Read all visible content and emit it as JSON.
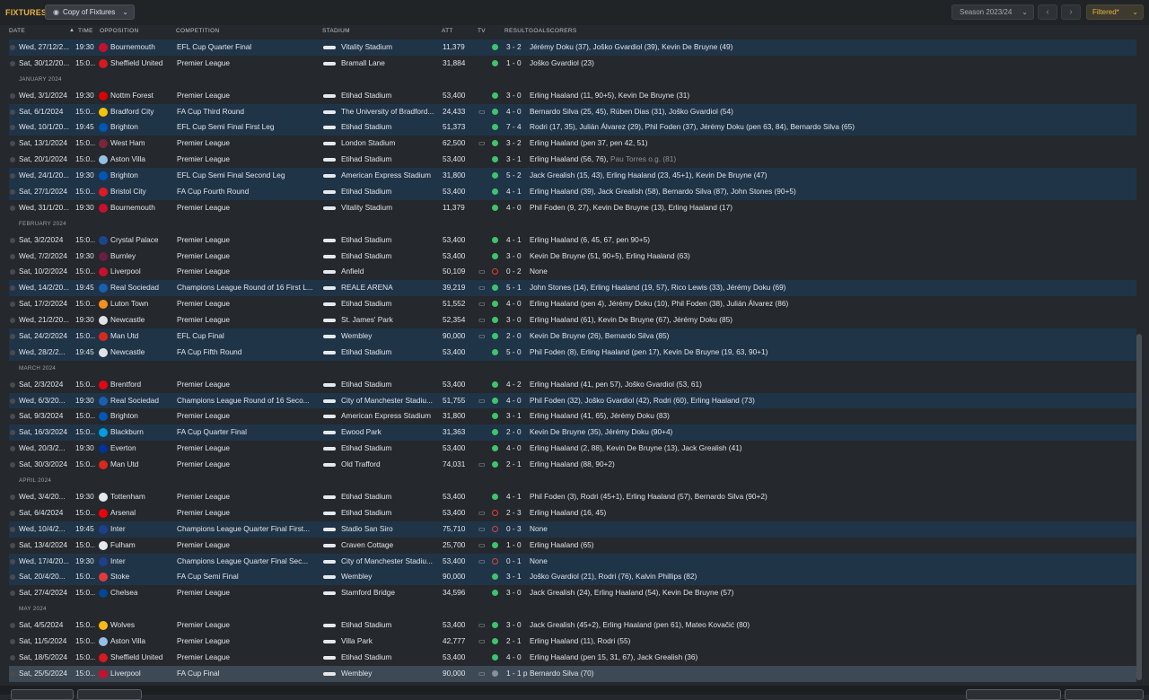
{
  "topbar": {
    "title": "FIXTURES",
    "view_label": "Copy of Fixtures",
    "view_icon": "eye-icon",
    "season_label": "Season 2023/24",
    "prev_icon": "chevron-left-icon",
    "next_icon": "chevron-right-icon",
    "filter_label": "Filtered*",
    "accent_color": "#e8b33c"
  },
  "columns": {
    "date": "DATE",
    "time": "TIME",
    "opposition": "OPPOSITION",
    "competition": "COMPETITION",
    "stadium": "STADIUM",
    "att": "ATT",
    "tv": "TV",
    "result": "RESULT",
    "goalscorers": "GOALSCORERS"
  },
  "rows": [
    {
      "type": "match",
      "alt": true,
      "date": "Wed, 27/12/2...",
      "time": "19:30",
      "badge": "#c8102e",
      "opp": "Bournemouth",
      "comp": "EFL Cup Quarter Final",
      "stadium": "Vitality Stadium",
      "att": "11,379",
      "tv": false,
      "res": "W",
      "score": "3 - 2",
      "scorers": "Jérémy Doku (37), Joško Gvardiol (39), Kevin De Bruyne (49)"
    },
    {
      "type": "match",
      "date": "Sat, 30/12/20...",
      "time": "15:0...",
      "badge": "#d71920",
      "opp": "Sheffield United",
      "comp": "Premier League",
      "stadium": "Bramall Lane",
      "att": "31,884",
      "tv": false,
      "res": "W",
      "score": "1 - 0",
      "scorers": "Joško Gvardiol (23)"
    },
    {
      "type": "month",
      "label": "JANUARY 2024"
    },
    {
      "type": "match",
      "date": "Wed, 3/1/2024",
      "time": "19:30",
      "badge": "#dd0000",
      "opp": "Nottm Forest",
      "comp": "Premier League",
      "stadium": "Etihad Stadium",
      "att": "53,400",
      "tv": false,
      "res": "W",
      "score": "3 - 0",
      "scorers": "Erling Haaland (11, 90+5), Kevin De Bruyne (31)"
    },
    {
      "type": "match",
      "alt": true,
      "date": "Sat, 6/1/2024",
      "time": "15:0...",
      "badge": "#f5c400",
      "opp": "Bradford City",
      "comp": "FA Cup Third Round",
      "stadium": "The University of Bradford...",
      "att": "24,433",
      "tv": true,
      "res": "W",
      "score": "4 - 0",
      "scorers": "Bernardo Silva (25, 45), Rúben Dias (31), Joško Gvardiol (54)"
    },
    {
      "type": "match",
      "alt": true,
      "date": "Wed, 10/1/20...",
      "time": "19:45",
      "badge": "#0057b8",
      "opp": "Brighton",
      "comp": "EFL Cup Semi Final First Leg",
      "stadium": "Etihad Stadium",
      "att": "51,373",
      "tv": false,
      "res": "W",
      "score": "7 - 4",
      "scorers": "Rodri (17, 35), Julián Álvarez (29), Phil Foden (37), Jérémy Doku (pen 63, 84), Bernardo Silva (65)"
    },
    {
      "type": "match",
      "date": "Sat, 13/1/2024",
      "time": "15:0...",
      "badge": "#7a263a",
      "opp": "West Ham",
      "comp": "Premier League",
      "stadium": "London Stadium",
      "att": "62,500",
      "tv": true,
      "res": "W",
      "score": "3 - 2",
      "scorers": "Erling Haaland (pen 37, pen 42, 51)"
    },
    {
      "type": "match",
      "date": "Sat, 20/1/2024",
      "time": "15:0...",
      "badge": "#95bfe5",
      "opp": "Aston Villa",
      "comp": "Premier League",
      "stadium": "Etihad Stadium",
      "att": "53,400",
      "tv": false,
      "res": "W",
      "score": "3 - 1",
      "scorers": "Erling Haaland (56, 76), ",
      "scorers_muted": "Pau Torres o.g. (81)"
    },
    {
      "type": "match",
      "alt": true,
      "date": "Wed, 24/1/20...",
      "time": "19:30",
      "badge": "#0057b8",
      "opp": "Brighton",
      "comp": "EFL Cup Semi Final Second Leg",
      "stadium": "American Express Stadium",
      "att": "31,800",
      "tv": false,
      "res": "W",
      "score": "5 - 2",
      "scorers": "Jack Grealish (15, 43), Erling Haaland (23, 45+1), Kevin De Bruyne (47)"
    },
    {
      "type": "match",
      "alt": true,
      "date": "Sat, 27/1/2024",
      "time": "15:0...",
      "badge": "#e21a23",
      "opp": "Bristol City",
      "comp": "FA Cup Fourth Round",
      "stadium": "Etihad Stadium",
      "att": "53,400",
      "tv": false,
      "res": "W",
      "score": "4 - 1",
      "scorers": "Erling Haaland (39), Jack Grealish (58), Bernardo Silva (87), John Stones (90+5)"
    },
    {
      "type": "match",
      "date": "Wed, 31/1/20...",
      "time": "19:30",
      "badge": "#c8102e",
      "opp": "Bournemouth",
      "comp": "Premier League",
      "stadium": "Vitality Stadium",
      "att": "11,379",
      "tv": false,
      "res": "W",
      "score": "4 - 0",
      "scorers": "Phil Foden (9, 27), Kevin De Bruyne (13), Erling Haaland (17)"
    },
    {
      "type": "month",
      "label": "FEBRUARY 2024"
    },
    {
      "type": "match",
      "date": "Sat, 3/2/2024",
      "time": "15:0...",
      "badge": "#1b458f",
      "opp": "Crystal Palace",
      "comp": "Premier League",
      "stadium": "Etihad Stadium",
      "att": "53,400",
      "tv": false,
      "res": "W",
      "score": "4 - 1",
      "scorers": "Erling Haaland (6, 45, 67, pen 90+5)"
    },
    {
      "type": "match",
      "date": "Wed, 7/2/2024",
      "time": "19:30",
      "badge": "#6c1d45",
      "opp": "Burnley",
      "comp": "Premier League",
      "stadium": "Etihad Stadium",
      "att": "53,400",
      "tv": false,
      "res": "W",
      "score": "3 - 0",
      "scorers": "Kevin De Bruyne (51, 90+5), Erling Haaland (63)"
    },
    {
      "type": "match",
      "date": "Sat, 10/2/2024",
      "time": "15:0...",
      "badge": "#c8102e",
      "opp": "Liverpool",
      "comp": "Premier League",
      "stadium": "Anfield",
      "att": "50,109",
      "tv": true,
      "res": "L",
      "score": "0 - 2",
      "scorers": "None"
    },
    {
      "type": "match",
      "alt": true,
      "date": "Wed, 14/2/20...",
      "time": "19:45",
      "badge": "#1c5faf",
      "opp": "Real Sociedad",
      "comp": "Champions League Round of 16  First L...",
      "stadium": "REALE ARENA",
      "att": "39,219",
      "tv": true,
      "res": "W",
      "score": "5 - 1",
      "scorers": "John Stones (14), Erling Haaland (19, 57), Rico Lewis (33), Jérémy Doku (69)"
    },
    {
      "type": "match",
      "date": "Sat, 17/2/2024",
      "time": "15:0...",
      "badge": "#f78f1e",
      "opp": "Luton Town",
      "comp": "Premier League",
      "stadium": "Etihad Stadium",
      "att": "51,552",
      "tv": true,
      "res": "W",
      "score": "4 - 0",
      "scorers": "Erling Haaland (pen 4), Jérémy Doku (10), Phil Foden (38), Julián Álvarez (86)"
    },
    {
      "type": "match",
      "date": "Wed, 21/2/20...",
      "time": "19:30",
      "badge": "#dfe3e6",
      "opp": "Newcastle",
      "comp": "Premier League",
      "stadium": "St. James' Park",
      "att": "52,354",
      "tv": true,
      "res": "W",
      "score": "3 - 0",
      "scorers": "Erling Haaland (61), Kevin De Bruyne (67), Jérémy Doku (85)"
    },
    {
      "type": "match",
      "alt": true,
      "date": "Sat, 24/2/2024",
      "time": "15:0...",
      "badge": "#da291c",
      "opp": "Man Utd",
      "comp": "EFL Cup Final",
      "stadium": "Wembley",
      "att": "90,000",
      "tv": true,
      "res": "W",
      "score": "2 - 0",
      "scorers": "Kevin De Bruyne (26), Bernardo Silva (85)"
    },
    {
      "type": "match",
      "alt": true,
      "date": "Wed, 28/2/2...",
      "time": "19:45",
      "badge": "#dfe3e6",
      "opp": "Newcastle",
      "comp": "FA Cup Fifth Round",
      "stadium": "Etihad Stadium",
      "att": "53,400",
      "tv": false,
      "res": "W",
      "score": "5 - 0",
      "scorers": "Phil Foden (8), Erling Haaland (pen 17), Kevin De Bruyne (19, 63, 90+1)"
    },
    {
      "type": "month",
      "label": "MARCH 2024"
    },
    {
      "type": "match",
      "date": "Sat, 2/3/2024",
      "time": "15:0...",
      "badge": "#e30613",
      "opp": "Brentford",
      "comp": "Premier League",
      "stadium": "Etihad Stadium",
      "att": "53,400",
      "tv": false,
      "res": "W",
      "score": "4 - 2",
      "scorers": "Erling Haaland (41, pen 57), Joško Gvardiol (53, 61)"
    },
    {
      "type": "match",
      "alt": true,
      "date": "Wed, 6/3/20...",
      "time": "19:30",
      "badge": "#1c5faf",
      "opp": "Real Sociedad",
      "comp": "Champions League Round of 16  Seco...",
      "stadium": "City of Manchester Stadiu...",
      "att": "51,755",
      "tv": true,
      "res": "W",
      "score": "4 - 0",
      "scorers": "Phil Foden (32), Joško Gvardiol (42), Rodri (60), Erling Haaland (73)"
    },
    {
      "type": "match",
      "date": "Sat, 9/3/2024",
      "time": "15:0...",
      "badge": "#0057b8",
      "opp": "Brighton",
      "comp": "Premier League",
      "stadium": "American Express Stadium",
      "att": "31,800",
      "tv": false,
      "res": "W",
      "score": "3 - 1",
      "scorers": "Erling Haaland (41, 65), Jérémy Doku (83)"
    },
    {
      "type": "match",
      "alt": true,
      "date": "Sat, 16/3/2024",
      "time": "15:0...",
      "badge": "#009ee0",
      "opp": "Blackburn",
      "comp": "FA Cup Quarter Final",
      "stadium": "Ewood Park",
      "att": "31,363",
      "tv": false,
      "res": "W",
      "score": "2 - 0",
      "scorers": "Kevin De Bruyne (35), Jérémy Doku (90+4)"
    },
    {
      "type": "match",
      "date": "Wed, 20/3/2...",
      "time": "19:30",
      "badge": "#003399",
      "opp": "Everton",
      "comp": "Premier League",
      "stadium": "Etihad Stadium",
      "att": "53,400",
      "tv": false,
      "res": "W",
      "score": "4 - 0",
      "scorers": "Erling Haaland (2, 88), Kevin De Bruyne (13), Jack Grealish (41)"
    },
    {
      "type": "match",
      "date": "Sat, 30/3/2024",
      "time": "15:0...",
      "badge": "#da291c",
      "opp": "Man Utd",
      "comp": "Premier League",
      "stadium": "Old Trafford",
      "att": "74,031",
      "tv": true,
      "res": "W",
      "score": "2 - 1",
      "scorers": "Erling Haaland (88, 90+2)"
    },
    {
      "type": "month",
      "label": "APRIL 2024"
    },
    {
      "type": "match",
      "date": "Wed, 3/4/20...",
      "time": "19:30",
      "badge": "#e6e9ec",
      "opp": "Tottenham",
      "comp": "Premier League",
      "stadium": "Etihad Stadium",
      "att": "53,400",
      "tv": false,
      "res": "W",
      "score": "4 - 1",
      "scorers": "Phil Foden (3), Rodri (45+1), Erling Haaland (57), Bernardo Silva (90+2)"
    },
    {
      "type": "match",
      "date": "Sat, 6/4/2024",
      "time": "15:0...",
      "badge": "#ef0107",
      "opp": "Arsenal",
      "comp": "Premier League",
      "stadium": "Etihad Stadium",
      "att": "53,400",
      "tv": true,
      "res": "L",
      "score": "2 - 3",
      "scorers": "Erling Haaland (16, 45)"
    },
    {
      "type": "match",
      "alt": true,
      "date": "Wed, 10/4/2...",
      "time": "19:45",
      "badge": "#1e3f8a",
      "opp": "Inter",
      "comp": "Champions League Quarter Final First...",
      "stadium": "Stadio San Siro",
      "att": "75,710",
      "tv": true,
      "res": "L",
      "score": "0 - 3",
      "scorers": "None"
    },
    {
      "type": "match",
      "date": "Sat, 13/4/2024",
      "time": "15:0...",
      "badge": "#e6e9ec",
      "opp": "Fulham",
      "comp": "Premier League",
      "stadium": "Craven Cottage",
      "att": "25,700",
      "tv": true,
      "res": "W",
      "score": "1 - 0",
      "scorers": "Erling Haaland (65)"
    },
    {
      "type": "match",
      "alt": true,
      "date": "Wed, 17/4/20...",
      "time": "19:30",
      "badge": "#1e3f8a",
      "opp": "Inter",
      "comp": "Champions League Quarter Final Sec...",
      "stadium": "City of Manchester Stadiu...",
      "att": "53,400",
      "tv": true,
      "res": "L",
      "score": "0 - 1",
      "scorers": "None"
    },
    {
      "type": "match",
      "alt": true,
      "date": "Sat, 20/4/20...",
      "time": "15:0...",
      "badge": "#e03a3e",
      "opp": "Stoke",
      "comp": "FA Cup Semi Final",
      "stadium": "Wembley",
      "att": "90,000",
      "tv": false,
      "res": "W",
      "score": "3 - 1",
      "scorers": "Joško Gvardiol (21), Rodri (76), Kalvin Phillips (82)"
    },
    {
      "type": "match",
      "date": "Sat, 27/4/2024",
      "time": "15:0...",
      "badge": "#034694",
      "opp": "Chelsea",
      "comp": "Premier League",
      "stadium": "Stamford Bridge",
      "att": "34,596",
      "tv": false,
      "res": "W",
      "score": "3 - 0",
      "scorers": "Jack Grealish (24), Erling Haaland (54), Kevin De Bruyne (57)"
    },
    {
      "type": "month",
      "label": "MAY 2024"
    },
    {
      "type": "match",
      "date": "Sat, 4/5/2024",
      "time": "15:0...",
      "badge": "#fdb913",
      "opp": "Wolves",
      "comp": "Premier League",
      "stadium": "Etihad Stadium",
      "att": "53,400",
      "tv": true,
      "res": "W",
      "score": "3 - 0",
      "scorers": "Jack Grealish (45+2), Erling Haaland (pen 61), Mateo Kovačić (80)"
    },
    {
      "type": "match",
      "date": "Sat, 11/5/2024",
      "time": "15:0...",
      "badge": "#95bfe5",
      "opp": "Aston Villa",
      "comp": "Premier League",
      "stadium": "Villa Park",
      "att": "42,777",
      "tv": true,
      "res": "W",
      "score": "2 - 1",
      "scorers": "Erling Haaland (11), Rodri (55)"
    },
    {
      "type": "match",
      "date": "Sat, 18/5/2024",
      "time": "15:0...",
      "badge": "#d71920",
      "opp": "Sheffield United",
      "comp": "Premier League",
      "stadium": "Etihad Stadium",
      "att": "53,400",
      "tv": false,
      "res": "W",
      "score": "4 - 0",
      "scorers": "Erling Haaland (pen 15, 31, 67), Jack Grealish (36)"
    },
    {
      "type": "match",
      "sel": true,
      "date": "Sat, 25/5/2024",
      "time": "15:0...",
      "badge": "#c8102e",
      "opp": "Liverpool",
      "comp": "FA Cup Final",
      "stadium": "Wembley",
      "att": "90,000",
      "tv": true,
      "res": "D",
      "score": "1 - 1 p",
      "scorers": "Bernardo Silva (70)"
    }
  ]
}
